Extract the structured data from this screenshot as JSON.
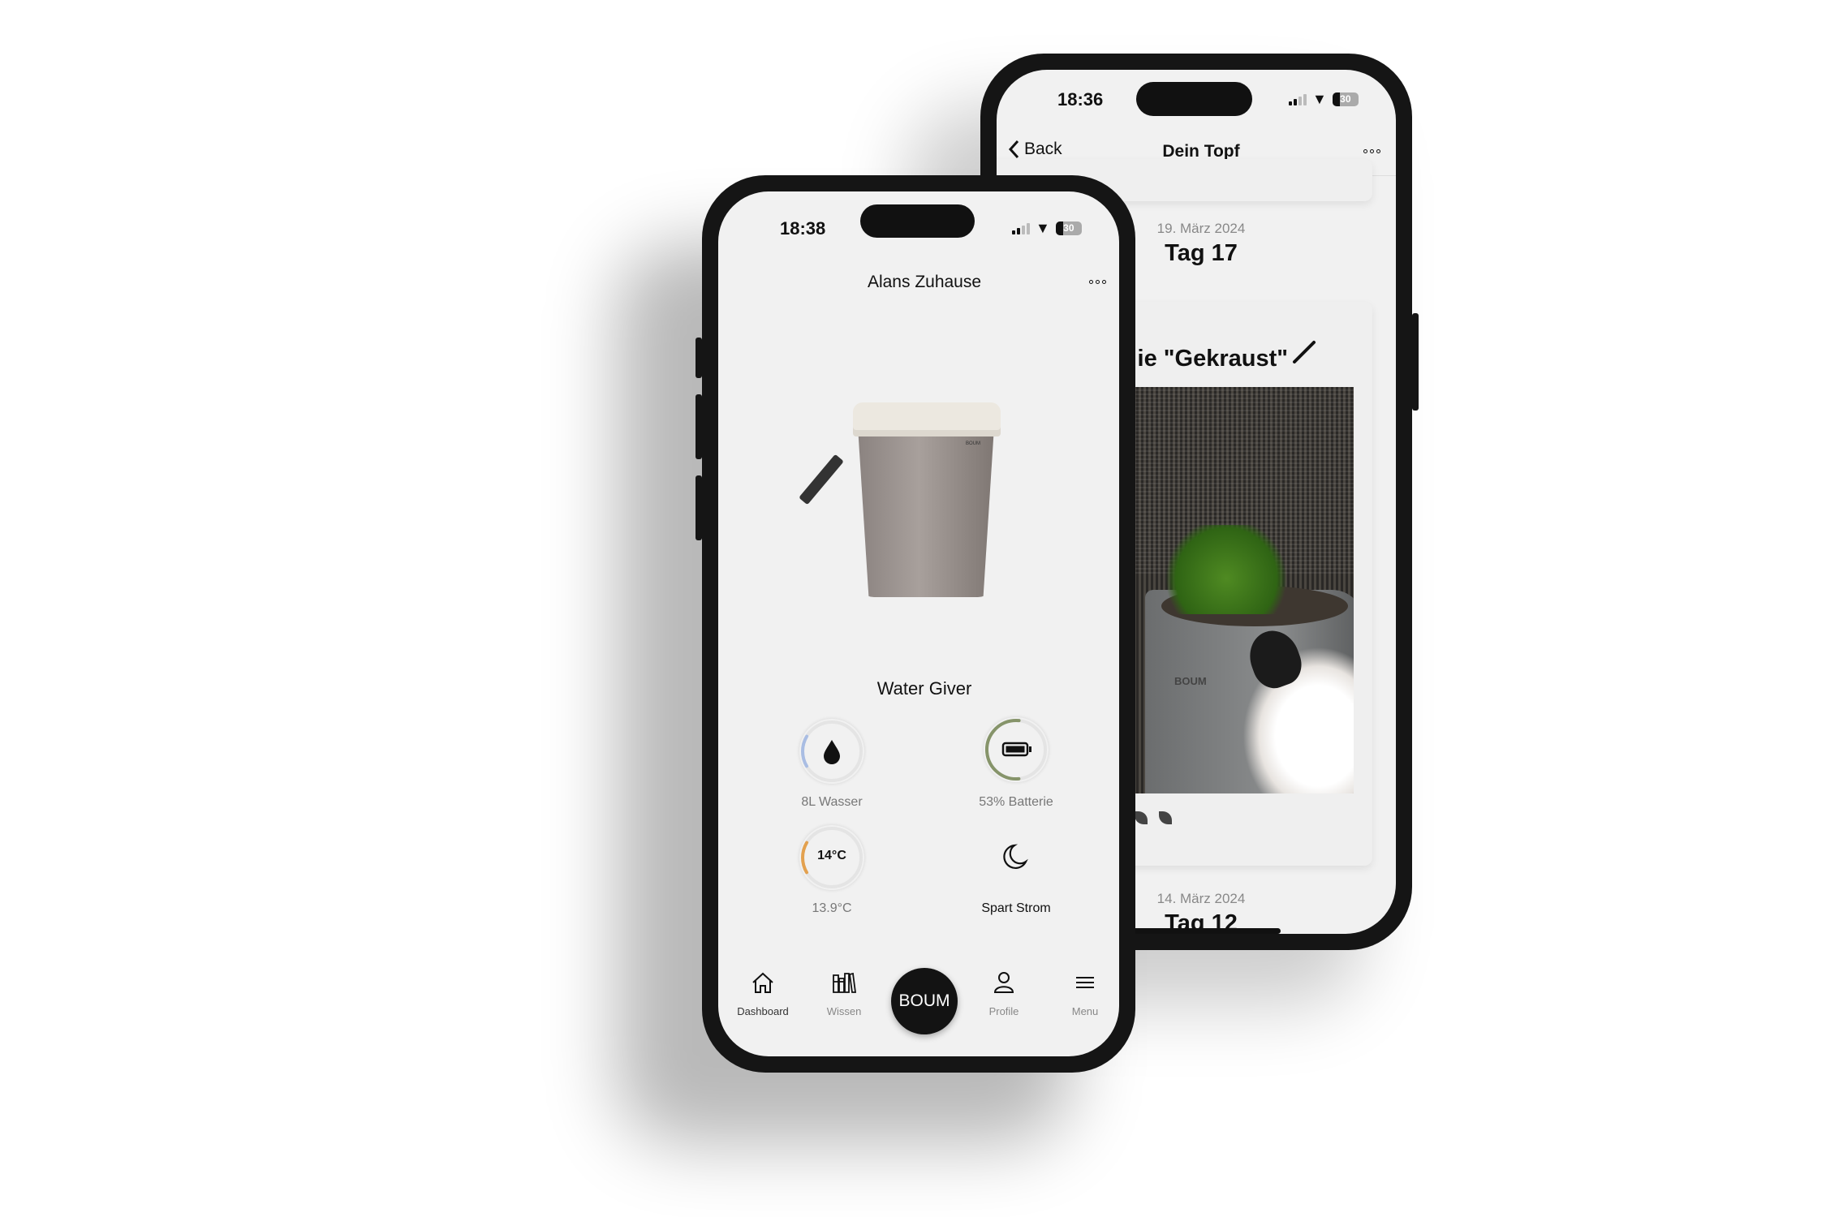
{
  "back_phone": {
    "status": {
      "time": "18:36",
      "battery": "30"
    },
    "nav": {
      "back_label": "Back",
      "title": "Dein Topf",
      "more_icon": "ellipsis-icon"
    },
    "entries": [
      {
        "date": "19. März 2024",
        "day": "Tag 17",
        "plant_title": "ie \"Gekraust\"",
        "photo_label": "BOUM"
      },
      {
        "date": "14. März 2024",
        "day": "Tag 12"
      }
    ]
  },
  "front_phone": {
    "status": {
      "time": "18:38",
      "battery": "30"
    },
    "header": {
      "title": "Alans Zuhause"
    },
    "pot": {
      "brand": "BOUM"
    },
    "device_name": "Water Giver",
    "gauges": [
      {
        "id": "water",
        "icon": "water-drop-icon",
        "label": "8L Wasser",
        "fill": 0.17,
        "color": "#a9bde3"
      },
      {
        "id": "battery",
        "icon": "battery-icon",
        "label": "53% Batterie",
        "fill": 0.53,
        "color": "#86946a"
      },
      {
        "id": "temperature",
        "value": "14°C",
        "label": "13.9°C",
        "fill": 0.17,
        "color": "#e3a14f"
      },
      {
        "id": "power",
        "icon": "moon-icon",
        "label": "Spart Strom"
      }
    ],
    "tabbar": [
      {
        "label": "Dashboard",
        "icon": "home-icon"
      },
      {
        "label": "Wissen",
        "icon": "books-icon"
      },
      {
        "label": "BOUM",
        "icon": "boum-logo"
      },
      {
        "label": "Profile",
        "icon": "profile-icon"
      },
      {
        "label": "Menu",
        "icon": "menu-icon"
      }
    ]
  }
}
